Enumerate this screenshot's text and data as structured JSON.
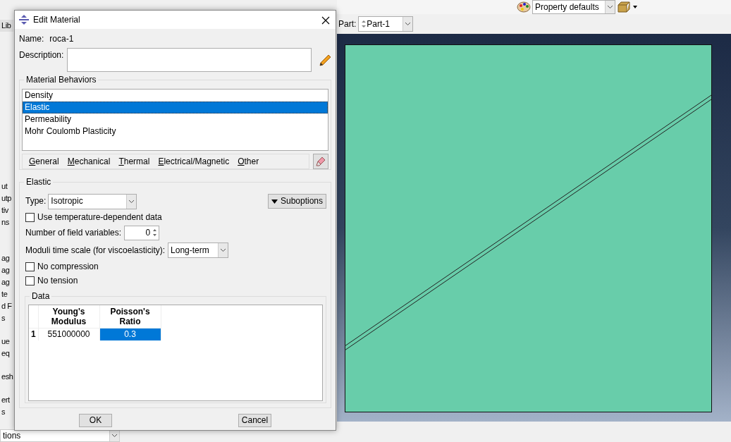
{
  "app": {
    "toolbar": {
      "display_group": "Property defaults"
    },
    "part_label": "Part:",
    "part": "Part-1",
    "left_panel": {
      "button": "Lib",
      "groups": [
        [
          "ut",
          "utp",
          "tiv",
          "ns"
        ],
        [
          "ag",
          "ag",
          "ag",
          "te",
          "d F",
          "s"
        ],
        [
          "ue",
          "eq"
        ],
        [
          "esh"
        ],
        [
          "ert",
          "s"
        ]
      ],
      "bottom_dropdown": "tions"
    }
  },
  "dialog": {
    "title": "Edit Material",
    "name_label": "Name:",
    "name": "roca-1",
    "description_label": "Description:",
    "behaviors_title": "Material Behaviors",
    "behaviors": [
      {
        "label": "Density",
        "selected": false
      },
      {
        "label": "Elastic",
        "selected": true
      },
      {
        "label": "Permeability",
        "selected": false
      },
      {
        "label": "Mohr Coulomb Plasticity",
        "selected": false
      }
    ],
    "menus": [
      "General",
      "Mechanical",
      "Thermal",
      "Electrical/Magnetic",
      "Other"
    ],
    "elastic": {
      "title": "Elastic",
      "type_label": "Type:",
      "type": "Isotropic",
      "suboptions": "Suboptions",
      "temperature": {
        "label": "Use temperature-dependent data",
        "checked": false
      },
      "field_vars_label": "Number of field variables:",
      "field_vars": "0",
      "moduli_label": "Moduli time scale (for viscoelasticity):",
      "moduli": "Long-term",
      "options": [
        {
          "label": "No compression",
          "checked": false
        },
        {
          "label": "No tension",
          "checked": false
        }
      ],
      "data_title": "Data",
      "table": {
        "columns": [
          "Young's Modulus",
          "Poisson's Ratio"
        ],
        "rows": [
          {
            "index": "1",
            "cells": [
              {
                "value": "551000000",
                "selected": false
              },
              {
                "value": "0.3",
                "selected": true
              }
            ]
          }
        ]
      }
    },
    "buttons": [
      "OK",
      "Cancel"
    ]
  }
}
